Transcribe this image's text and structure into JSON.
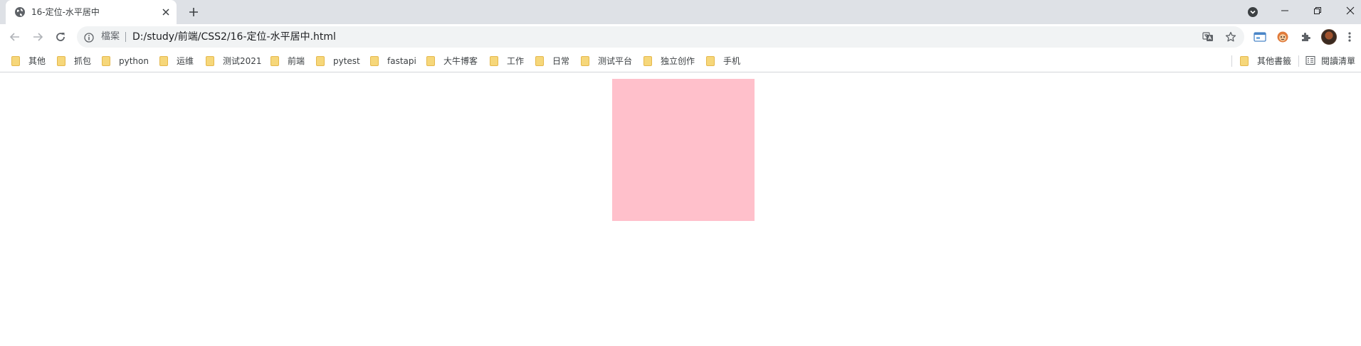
{
  "tab": {
    "title": "16-定位-水平居中",
    "favicon": "globe-icon"
  },
  "address_bar": {
    "site_label": "檔案",
    "url": "D:/study/前端/CSS2/16-定位-水平居中.html"
  },
  "bookmarks": {
    "items": [
      {
        "label": "其他",
        "icon": "folder-icon"
      },
      {
        "label": "抓包",
        "icon": "folder-icon"
      },
      {
        "label": "python",
        "icon": "folder-icon"
      },
      {
        "label": "运维",
        "icon": "folder-icon"
      },
      {
        "label": "测试2021",
        "icon": "folder-icon"
      },
      {
        "label": "前端",
        "icon": "folder-icon"
      },
      {
        "label": "pytest",
        "icon": "folder-icon"
      },
      {
        "label": "fastapi",
        "icon": "folder-icon"
      },
      {
        "label": "大牛博客",
        "icon": "folder-icon"
      },
      {
        "label": "工作",
        "icon": "folder-icon"
      },
      {
        "label": "日常",
        "icon": "folder-icon"
      },
      {
        "label": "测试平台",
        "icon": "folder-icon"
      },
      {
        "label": "独立创作",
        "icon": "folder-icon"
      },
      {
        "label": "手机",
        "icon": "folder-icon"
      }
    ],
    "other_bookmarks": "其他書籤",
    "reading_list": "閱讀清單"
  },
  "page": {
    "box_color": "#ffc0cb"
  },
  "colors": {
    "tabstrip_bg": "#dee1e6",
    "omnibox_bg": "#f1f3f4",
    "folder_yellow": "#f6d77a"
  }
}
